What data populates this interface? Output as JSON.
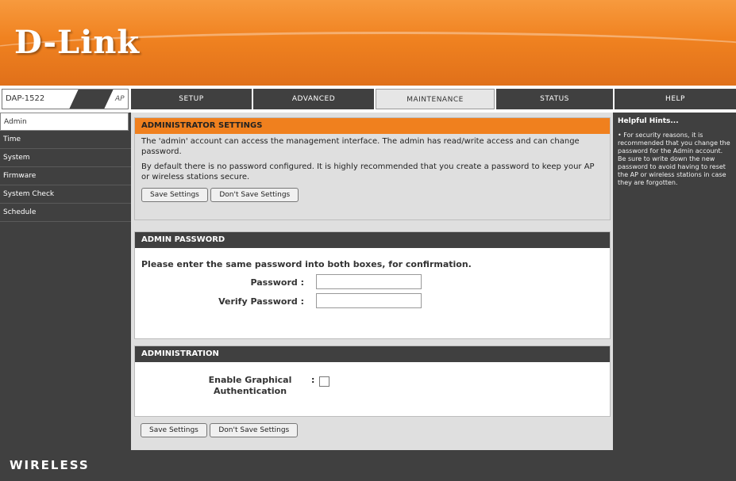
{
  "brand": {
    "logo": "D-Link",
    "logo_suffix": ""
  },
  "model": {
    "name": "DAP-1522",
    "mode": "AP"
  },
  "tabs": [
    {
      "label": "SETUP",
      "active": false
    },
    {
      "label": "ADVANCED",
      "active": false
    },
    {
      "label": "MAINTENANCE",
      "active": true
    },
    {
      "label": "STATUS",
      "active": false
    },
    {
      "label": "HELP",
      "active": false
    }
  ],
  "sidebar": {
    "items": [
      {
        "label": "Admin",
        "active": true
      },
      {
        "label": "Time"
      },
      {
        "label": "System"
      },
      {
        "label": "Firmware"
      },
      {
        "label": "System Check"
      },
      {
        "label": "Schedule"
      }
    ]
  },
  "admin_settings": {
    "title": "ADMINISTRATOR SETTINGS",
    "paragraph1": "The 'admin' account can access the management interface. The admin has read/write access and can change password.",
    "paragraph2": "By default there is no password configured. It is highly recommended that you create a password to keep your AP or wireless stations secure.",
    "save_label": "Save Settings",
    "dont_save_label": "Don't Save Settings"
  },
  "admin_password": {
    "title": "ADMIN PASSWORD",
    "instructions": "Please enter the same password into both boxes, for confirmation.",
    "password_label": "Password :",
    "verify_label": "Verify Password :",
    "password_value": "",
    "verify_value": ""
  },
  "administration": {
    "title": "ADMINISTRATION",
    "graphical_auth_label": "Enable Graphical Authentication",
    "graphical_auth_checked": false
  },
  "bottom_buttons": {
    "save_label": "Save Settings",
    "dont_save_label": "Don't Save Settings"
  },
  "help": {
    "title": "Helpful Hints...",
    "text": "• For security reasons, it is recommended that you change the password for the Admin account. Be sure to write down the new password to avoid having to reset the AP or wireless stations in case they are forgotten."
  },
  "footer": {
    "label": "WIRELESS"
  },
  "colors": {
    "accent": "#f0801e",
    "dark": "#404040",
    "panel": "#dfdfdf"
  }
}
